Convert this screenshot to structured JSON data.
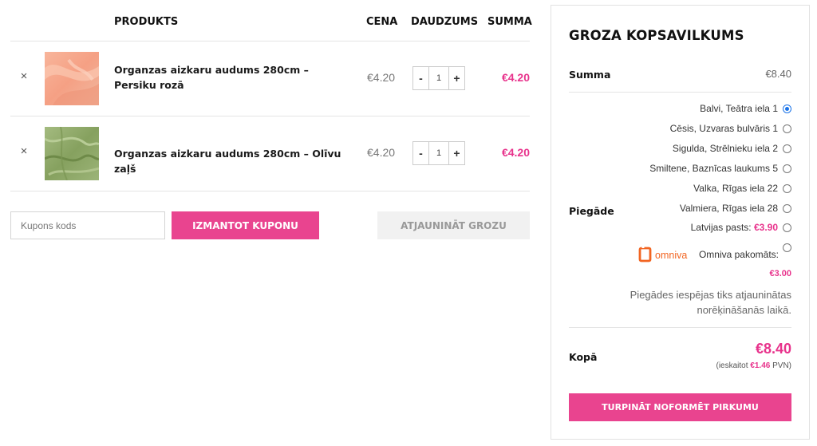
{
  "cart": {
    "headers": {
      "product": "PRODUKTS",
      "price": "CENA",
      "quantity": "DAUDZUMS",
      "sum": "SUMMA"
    },
    "remove_icon": "×",
    "items": [
      {
        "name": "Organzas aizkaru audums 280cm – Persiku rozā",
        "price": "€4.20",
        "qty_minus": "-",
        "qty": "1",
        "qty_plus": "+",
        "sum": "€4.20",
        "swatch_color": "#f5a98d"
      },
      {
        "name": "Organzas aizkaru audums 280cm – Olīvu zaļš",
        "price": "€4.20",
        "qty_minus": "-",
        "qty": "1",
        "qty_plus": "+",
        "sum": "€4.20",
        "swatch_color": "#8fa96a"
      }
    ],
    "coupon_placeholder": "Kupons kods",
    "apply_coupon_label": "IZMANTOT KUPONU",
    "update_cart_label": "ATJAUNINĀT GROZU"
  },
  "summary": {
    "title": "GROZA KOPSAVILKUMS",
    "subtotal_label": "Summa",
    "subtotal_value": "€8.40",
    "shipping_label": "Piegāde",
    "shipping_options": [
      {
        "label": "Balvi, Teātra iela 1",
        "price": "",
        "selected": true
      },
      {
        "label": "Cēsis, Uzvaras bulvāris 1",
        "price": "",
        "selected": false
      },
      {
        "label": "Sigulda, Strēlnieku iela 2",
        "price": "",
        "selected": false
      },
      {
        "label": "Smiltene, Baznīcas laukums 5",
        "price": "",
        "selected": false
      },
      {
        "label": "Valka, Rīgas iela 22",
        "price": "",
        "selected": false
      },
      {
        "label": "Valmiera, Rīgas iela 28",
        "price": "",
        "selected": false
      },
      {
        "label": "Latvijas pasts: ",
        "price": "€3.90",
        "selected": false
      }
    ],
    "omniva": {
      "logo_text": "omniva",
      "label": "Omniva pakomāts:",
      "price": "€3.00"
    },
    "shipping_note": "Piegādes iespējas tiks atjauninātas norēķināšanās laikā.",
    "total_label": "Kopā",
    "total_value": "€8.40",
    "tax_prefix": "(ieskaitot ",
    "tax_value": "€1.46",
    "tax_suffix": " PVN)",
    "checkout_label": "TURPINĀT NOFORMĒT PIRKUMU"
  },
  "colors": {
    "accent": "#e9448f",
    "price_pink": "#e8338c",
    "omniva_orange": "#f26522"
  }
}
